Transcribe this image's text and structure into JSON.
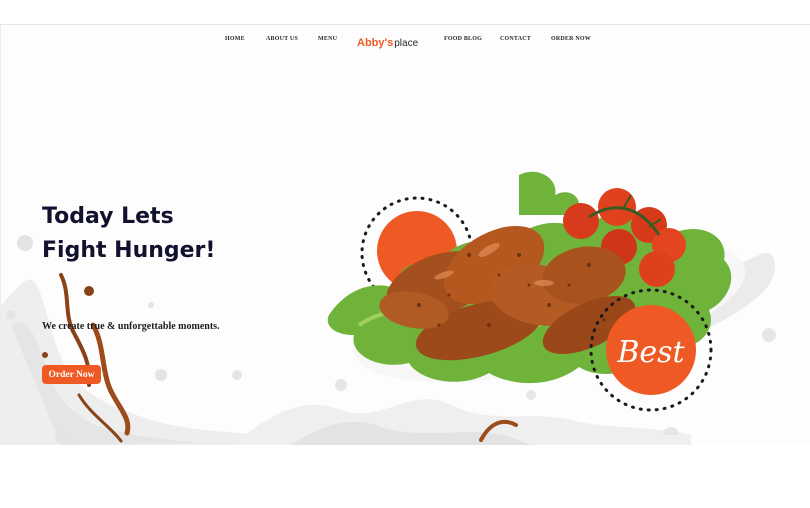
{
  "nav": {
    "items": [
      "HOME",
      "ABOUT US",
      "MENU",
      "FOOD BLOG",
      "CONTACT",
      "ORDER NOW"
    ],
    "logo_part1": "Abby's",
    "logo_part2": "place"
  },
  "hero": {
    "title_line1": "Today Lets",
    "title_line2": "Fight Hunger!",
    "tagline": "We create true & unforgettable moments.",
    "cta_label": "Order Now",
    "badge_text": "Best"
  },
  "colors": {
    "accent": "#ef5a24",
    "heading": "#12122e",
    "text": "#2b2b2b",
    "background": "#ffffff"
  }
}
